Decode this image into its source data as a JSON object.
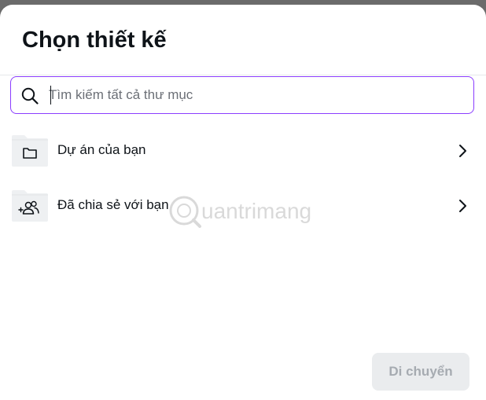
{
  "dialog": {
    "title": "Chọn thiết kế"
  },
  "search": {
    "placeholder": "Tìm kiếm tất cả thư mục",
    "value": ""
  },
  "folders": [
    {
      "label": "Dự án của bạn",
      "icon": "folder-icon"
    },
    {
      "label": "Đã chia sẻ với bạn",
      "icon": "shared-people-icon"
    }
  ],
  "footer": {
    "move_label": "Di chuyển"
  },
  "watermark": {
    "text": "uantrimang"
  },
  "colors": {
    "accent": "#8b3dff",
    "text": "#0e1318",
    "disabled_bg": "#eaecee",
    "disabled_text": "#a6abb1"
  }
}
